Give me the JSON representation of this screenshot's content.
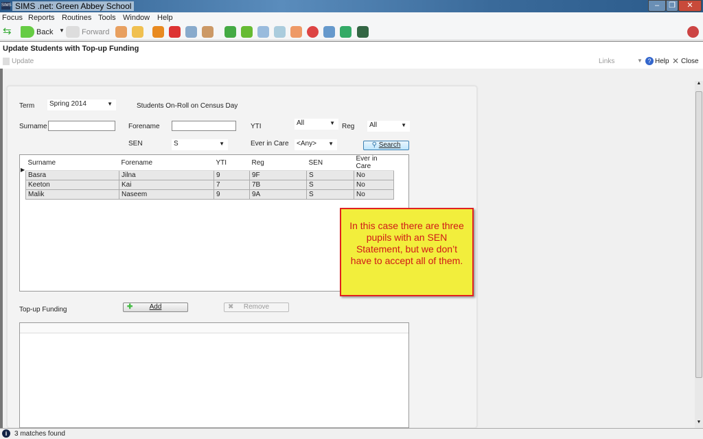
{
  "window": {
    "title": "SIMS .net: Green Abbey School",
    "app_badge": "SIMS"
  },
  "menu": [
    "Focus",
    "Reports",
    "Routines",
    "Tools",
    "Window",
    "Help"
  ],
  "toolbar": {
    "back": "Back",
    "forward": "Forward"
  },
  "page": {
    "title": "Update Students with Top-up Funding",
    "update": "Update",
    "links": "Links",
    "help": "Help",
    "close": "Close"
  },
  "filters": {
    "term_label": "Term",
    "term_value": "Spring 2014",
    "census_note": "Students On-Roll on Census Day",
    "surname_label": "Surname",
    "surname_value": "",
    "forename_label": "Forename",
    "forename_value": "",
    "yti_label": "YTI",
    "yti_value": "All",
    "reg_label": "Reg",
    "reg_value": "All",
    "sen_label": "SEN",
    "sen_value": "S",
    "care_label": "Ever in Care",
    "care_value": "<Any>",
    "search": "Search"
  },
  "students": {
    "columns": [
      "Surname",
      "Forename",
      "YTI",
      "Reg",
      "SEN",
      "Ever in Care"
    ],
    "rows": [
      [
        "Basra",
        "Jilna",
        "9",
        "9F",
        "S",
        "No"
      ],
      [
        "Keeton",
        "Kai",
        "7",
        "7B",
        "S",
        "No"
      ],
      [
        "Malik",
        "Naseem",
        "9",
        "9A",
        "S",
        "No"
      ]
    ]
  },
  "topup": {
    "label": "Top-up Funding",
    "add": "Add",
    "remove": "Remove"
  },
  "callout": "In this case there are three pupils with an SEN Statement, but we don’t have to accept all of them.",
  "status": "3 matches found"
}
